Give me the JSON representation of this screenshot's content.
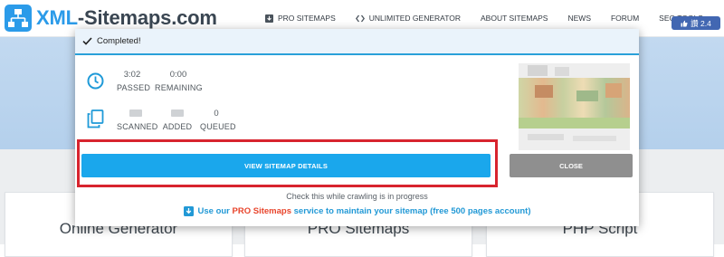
{
  "header": {
    "logo_part1": "XML",
    "logo_part2": "-Sitemaps.com",
    "nav": [
      {
        "label": "PRO SITEMAPS",
        "icon": "download-box-icon"
      },
      {
        "label": "UNLIMITED GENERATOR",
        "icon": "code-brackets-icon"
      },
      {
        "label": "ABOUT SITEMAPS"
      },
      {
        "label": "NEWS"
      },
      {
        "label": "FORUM"
      },
      {
        "label": "SEO TOOLS"
      }
    ],
    "like": {
      "label": "讚 2.4",
      "icon": "thumbs-up-icon"
    }
  },
  "cards": [
    {
      "title": "Online Generator"
    },
    {
      "title": "PRO Sitemaps"
    },
    {
      "title": "PHP Script"
    }
  ],
  "modal": {
    "title": "Completed!",
    "time": {
      "passed_value": "3:02",
      "passed_label": "PASSED",
      "remaining_value": "0:00",
      "remaining_label": "REMAINING"
    },
    "pages": {
      "scanned_label": "SCANNED",
      "added_label": "ADDED",
      "queued_value": "0",
      "queued_label": "QUEUED"
    },
    "view_button": "VIEW SITEMAP DETAILS",
    "close_button": "CLOSE",
    "hint": "Check this while crawling is in progress",
    "promo_before": "Use our ",
    "promo_link": "PRO Sitemaps",
    "promo_after": " service to maintain your sitemap (free 500 pages account)"
  },
  "colors": {
    "accent_blue": "#1aa7ec",
    "highlight_red": "#d8242e",
    "close_gray": "#8f8f8f",
    "logo_blue": "#2b9be9",
    "promo_red": "#e8452c"
  }
}
